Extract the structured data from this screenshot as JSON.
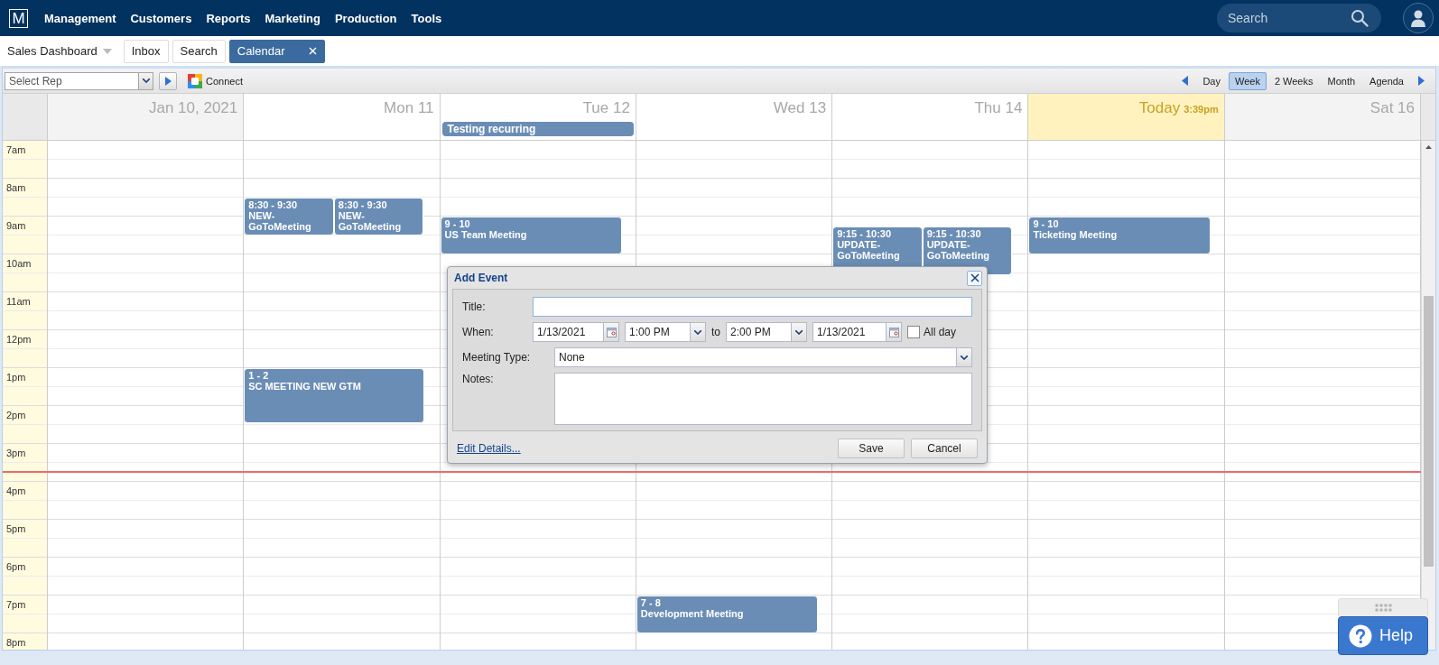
{
  "nav": {
    "logo": "M",
    "menu": [
      "Management",
      "Customers",
      "Reports",
      "Marketing",
      "Production",
      "Tools"
    ],
    "search": {
      "placeholder": "Search"
    }
  },
  "tabs": [
    {
      "label": "Sales Dashboard",
      "kind": "dropdown",
      "selected": false
    },
    {
      "label": "Inbox",
      "kind": "plain",
      "selected": false
    },
    {
      "label": "Search",
      "kind": "plain",
      "selected": false
    },
    {
      "label": "Calendar",
      "kind": "closable",
      "selected": true
    }
  ],
  "toolbar": {
    "rep_select": {
      "placeholder": "Select Rep"
    },
    "connect": "Connect",
    "views": [
      {
        "label": "Day",
        "selected": false
      },
      {
        "label": "Week",
        "selected": true
      },
      {
        "label": "2 Weeks",
        "selected": false
      },
      {
        "label": "Month",
        "selected": false
      },
      {
        "label": "Agenda",
        "selected": false
      }
    ]
  },
  "days": [
    {
      "label": "Jan 10, 2021",
      "today": false,
      "weekend": true
    },
    {
      "label": "Mon 11",
      "today": false,
      "weekend": false,
      "events": [
        {
          "time": "8:30 - 9:30",
          "title": "NEW-GoToMeeting"
        },
        {
          "time": "8:30 - 9:30",
          "title": "NEW-GoToMeeting"
        },
        {
          "time": "1 - 2",
          "title": "SC MEETING NEW GTM"
        }
      ]
    },
    {
      "label": "Tue 12",
      "today": false,
      "weekend": false,
      "all_day": [
        "Testing recurring"
      ],
      "events": [
        {
          "time": "9 - 10",
          "title": "US Team Meeting"
        }
      ]
    },
    {
      "label": "Wed 13",
      "today": false,
      "weekend": false,
      "events": [
        {
          "time": "7 - 8",
          "title": "Development Meeting"
        }
      ]
    },
    {
      "label": "Thu 14",
      "today": false,
      "weekend": false,
      "events": [
        {
          "time": "9:15 - 10:30",
          "title": "UPDATE-GoToMeeting"
        },
        {
          "time": "9:15 - 10:30",
          "title": "UPDATE-GoToMeeting"
        }
      ]
    },
    {
      "label": "Today",
      "time": "3:39pm",
      "today": true,
      "weekend": false,
      "events": [
        {
          "time": "9 - 10",
          "title": "Ticketing Meeting"
        }
      ]
    },
    {
      "label": "Sat 16",
      "today": false,
      "weekend": true
    }
  ],
  "hours": [
    "7am",
    "8am",
    "9am",
    "10am",
    "11am",
    "12pm",
    "1pm",
    "2pm",
    "3pm",
    "4pm",
    "5pm",
    "6pm",
    "7pm",
    "8pm"
  ],
  "dialog": {
    "title": "Add Event",
    "title_field": {
      "label": "Title:"
    },
    "when": {
      "label": "When:",
      "start_date": "1/13/2021",
      "start_time": "1:00 PM",
      "separator": "to",
      "end_time": "2:00 PM",
      "end_date": "1/13/2021",
      "all_day": {
        "label": "All day",
        "checked": false
      }
    },
    "meeting_type": {
      "label": "Meeting Type:",
      "value": "None"
    },
    "notes": {
      "label": "Notes:"
    },
    "link": "Edit Details...",
    "buttons": [
      "Save",
      "Cancel"
    ]
  },
  "help": {
    "label": "Help"
  }
}
